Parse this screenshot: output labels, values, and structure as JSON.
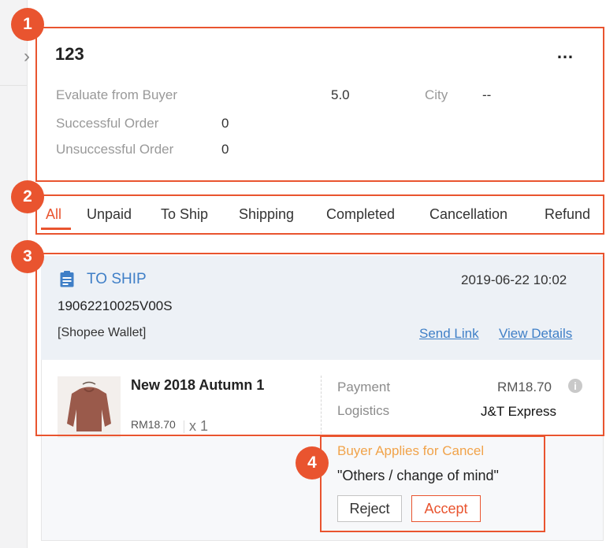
{
  "buyer": {
    "name": "123",
    "more_icon": "…",
    "stats": {
      "evaluate_label": "Evaluate from Buyer",
      "evaluate_value": "5.0",
      "city_label": "City",
      "city_value": "--",
      "successful_label": "Successful Order",
      "successful_value": "0",
      "unsuccessful_label": "Unsuccessful Order",
      "unsuccessful_value": "0"
    }
  },
  "tabs": [
    {
      "label": "All",
      "active": true
    },
    {
      "label": "Unpaid"
    },
    {
      "label": "To Ship"
    },
    {
      "label": "Shipping"
    },
    {
      "label": "Completed"
    },
    {
      "label": "Cancellation"
    },
    {
      "label": "Refund"
    }
  ],
  "order": {
    "status": "TO SHIP",
    "datetime": "2019-06-22 10:02",
    "id": "19062210025V00S",
    "payment_method": "[Shopee Wallet]",
    "send_link": "Send Link",
    "view_details": "View Details",
    "product": {
      "name": "New 2018 Autumn 1",
      "price": "RM18.70",
      "qty": "x 1"
    },
    "payment_label": "Payment",
    "payment_value": "RM18.70",
    "logistics_label": "Logistics",
    "logistics_value": "J&T Express"
  },
  "cancel_request": {
    "title": "Buyer Applies for Cancel",
    "reason": "\"Others / change of mind\"",
    "reject_label": "Reject",
    "accept_label": "Accept"
  },
  "annotations": {
    "badge_1": "1",
    "badge_2": "2",
    "badge_3": "3",
    "badge_4": "4"
  },
  "colors": {
    "highlight": "#e9542f",
    "link": "#3f7fc7",
    "warning": "#f1a34a"
  }
}
